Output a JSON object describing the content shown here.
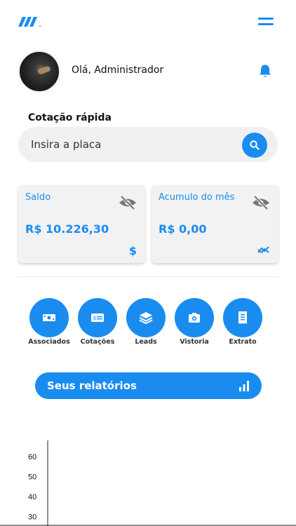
{
  "colors": {
    "accent": "#1a8cf0",
    "card_bg": "#f2f2f2",
    "search_bg": "#f0f0f0"
  },
  "header": {
    "logo_icon": "brand-slashes-logo",
    "menu_icon": "hamburger-icon"
  },
  "profile": {
    "greeting": "Olá, Administrador",
    "notification_icon": "bell-icon"
  },
  "quick_quote": {
    "title": "Cotação rápida",
    "placeholder": "Insira a placa",
    "search_icon": "search-icon"
  },
  "cards": {
    "saldo": {
      "label": "Saldo",
      "value": "R$ 10.226,30",
      "icon": "dollar-icon",
      "icon_glyph": "$",
      "visibility_icon": "eye-off-icon"
    },
    "acumulo": {
      "label": "Acumulo do mês",
      "value": "R$ 0,00",
      "icon": "trend-icon",
      "visibility_icon": "eye-off-icon"
    }
  },
  "actions": [
    {
      "label": "Associados",
      "icon": "money-icon"
    },
    {
      "label": "Cotações",
      "icon": "check-icon"
    },
    {
      "label": "Leads",
      "icon": "layers-icon"
    },
    {
      "label": "Vistoria",
      "icon": "camera-icon"
    },
    {
      "label": "Extrato",
      "icon": "receipt-icon"
    }
  ],
  "reports": {
    "label": "Seus relatórios",
    "icon": "bar-chart-icon"
  },
  "chart_data": {
    "type": "bar",
    "title": "",
    "xlabel": "",
    "ylabel": "",
    "categories": [],
    "values": [],
    "yticks": [
      60,
      50,
      40,
      30
    ],
    "ylim_visible": [
      30,
      60
    ]
  }
}
